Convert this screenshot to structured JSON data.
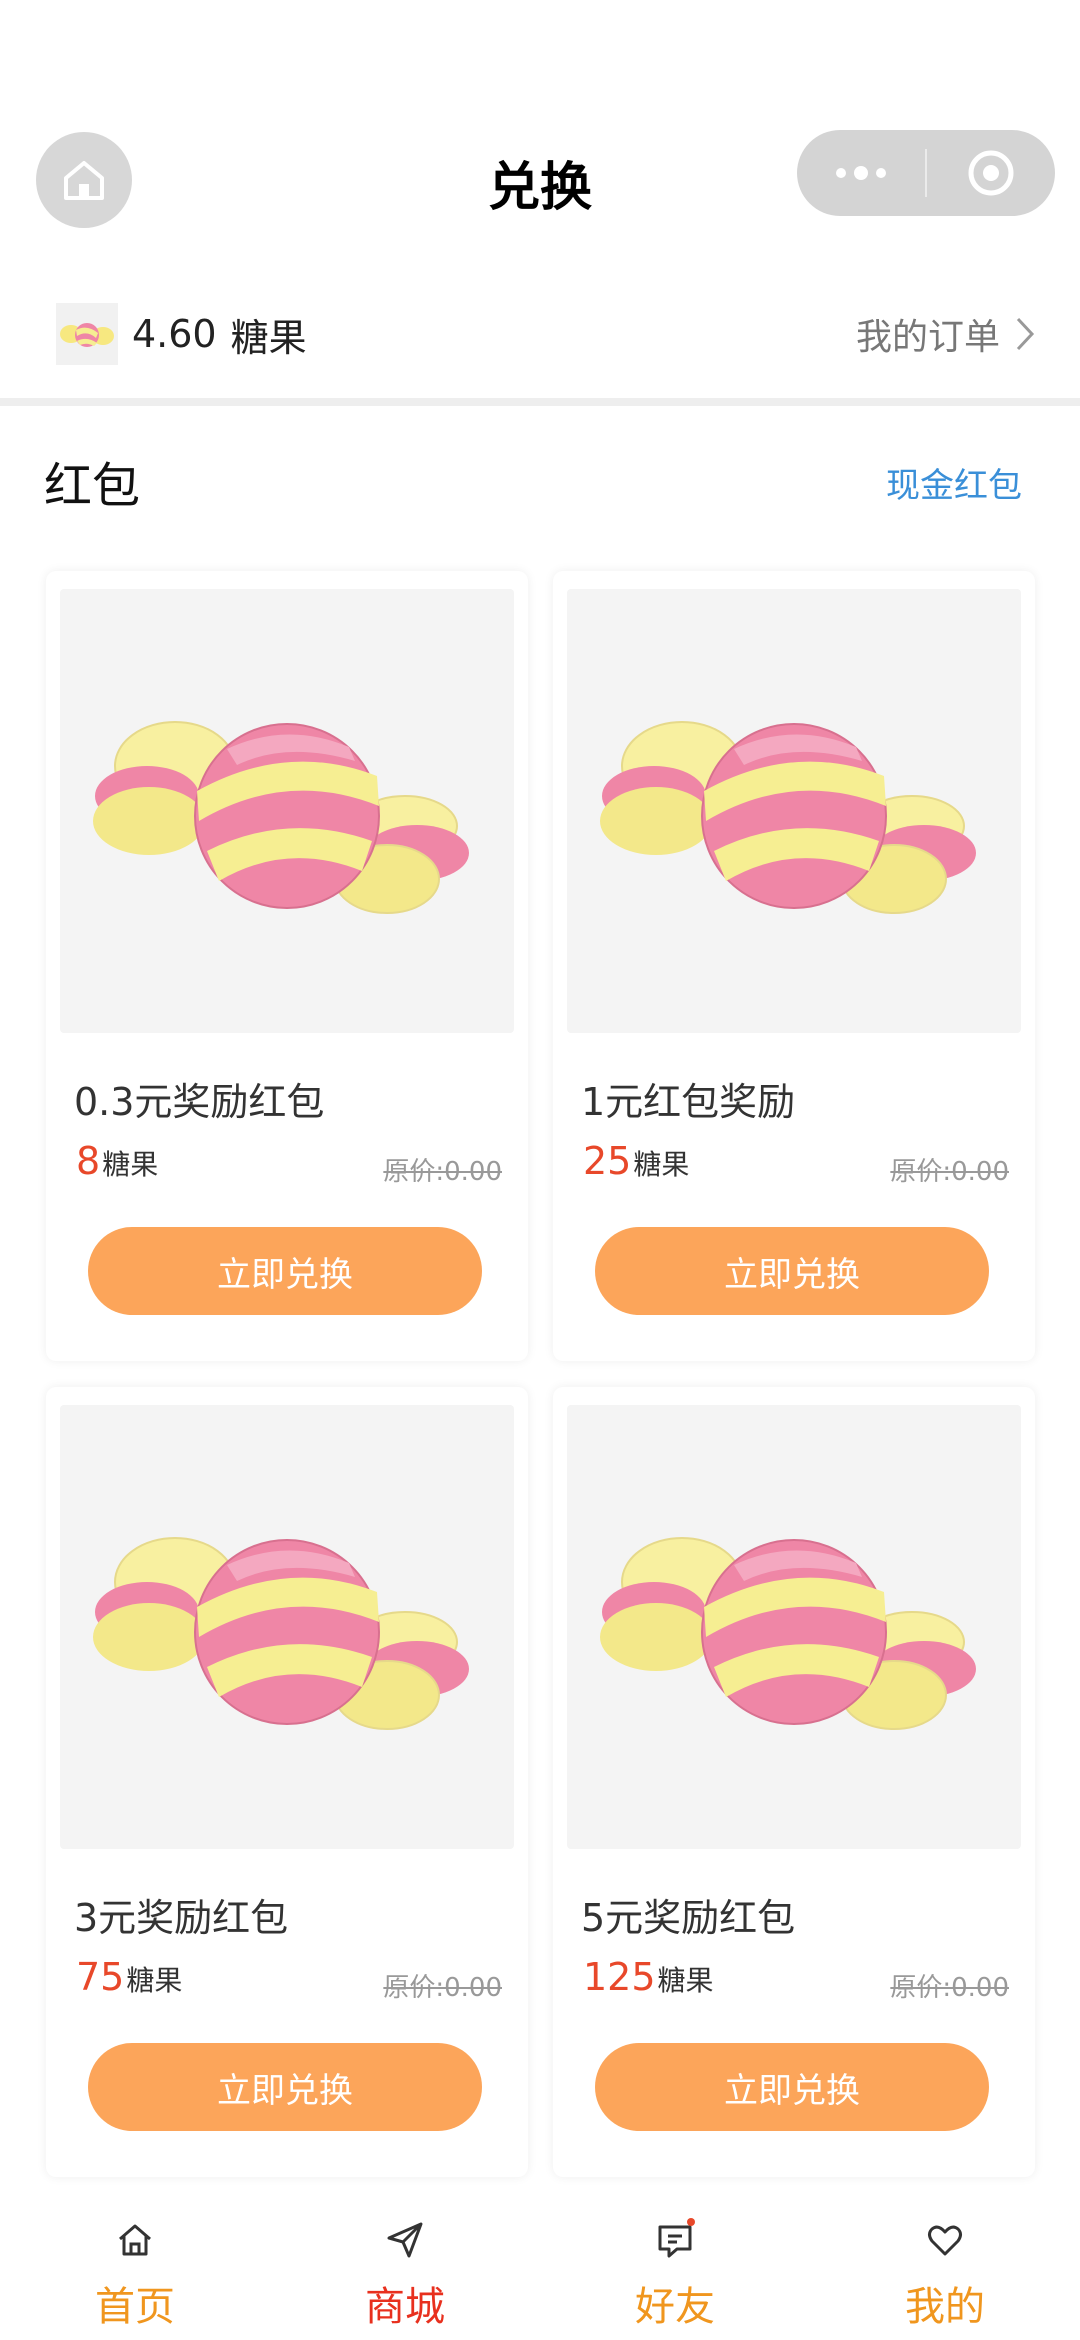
{
  "nav": {
    "title": "兑换",
    "home_icon": "home-icon",
    "more_icon": "more-dots-icon",
    "close_icon": "target-close-icon"
  },
  "balance": {
    "value": "4.60",
    "unit": "糖果",
    "orders_label": "我的订单"
  },
  "section": {
    "title": "红包",
    "link": "现金红包"
  },
  "products": [
    {
      "name": "0.3元奖励红包",
      "price": "8",
      "unit": "糖果",
      "original": "原价:0.00",
      "button": "立即兑换"
    },
    {
      "name": "1元红包奖励",
      "price": "25",
      "unit": "糖果",
      "original": "原价:0.00",
      "button": "立即兑换"
    },
    {
      "name": "3元奖励红包",
      "price": "75",
      "unit": "糖果",
      "original": "原价:0.00",
      "button": "立即兑换"
    },
    {
      "name": "5元奖励红包",
      "price": "125",
      "unit": "糖果",
      "original": "原价:0.00",
      "button": "立即兑换"
    }
  ],
  "tabbar": [
    {
      "label": "首页",
      "icon": "home-outline-icon",
      "color": "#f0961e",
      "active": false
    },
    {
      "label": "商城",
      "icon": "send-icon",
      "color": "#e8301e",
      "active": true
    },
    {
      "label": "好友",
      "icon": "chat-icon",
      "color": "#f0961e",
      "active": false,
      "badge": true
    },
    {
      "label": "我的",
      "icon": "heart-icon",
      "color": "#f0961e",
      "active": false
    }
  ],
  "colors": {
    "accent_orange": "#fca55a",
    "price_red": "#e8482a",
    "link_blue": "#3a8fd8"
  }
}
